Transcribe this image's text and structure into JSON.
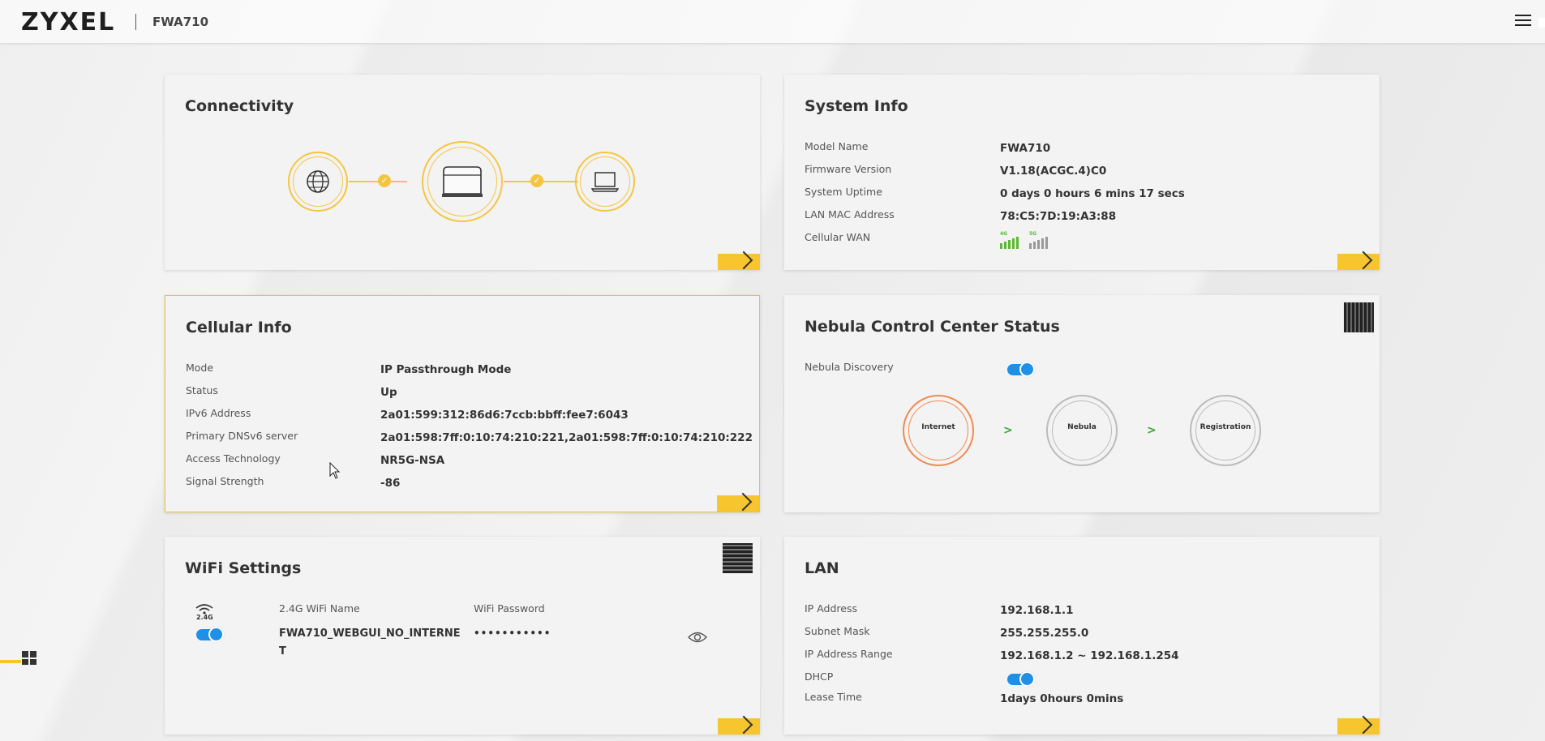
{
  "header": {
    "brand": "ZYXEL",
    "model": "FWA710"
  },
  "connectivity": {
    "title": "Connectivity"
  },
  "system_info": {
    "title": "System Info",
    "rows": [
      {
        "label": "Model Name",
        "value": "FWA710"
      },
      {
        "label": "Firmware Version",
        "value": "V1.18(ACGC.4)C0"
      },
      {
        "label": "System Uptime",
        "value": "0 days 0 hours 6 mins 17 secs"
      },
      {
        "label": "LAN MAC Address",
        "value": "78:C5:7D:19:A3:88"
      },
      {
        "label": "Cellular WAN",
        "value": ""
      }
    ],
    "signal_4g": "4G",
    "signal_5g": "5G",
    "colors": {
      "4g": "#5cb832",
      "5g": "#999999"
    }
  },
  "cellular_info": {
    "title": "Cellular Info",
    "rows": [
      {
        "label": "Mode",
        "value": "IP Passthrough Mode"
      },
      {
        "label": "Status",
        "value": "Up"
      },
      {
        "label": "IPv6 Address",
        "value": "2a01:599:312:86d6:7ccb:bbff:fee7:6043"
      },
      {
        "label": "Primary DNSv6 server",
        "value": "2a01:598:7ff:0:10:74:210:221,2a01:598:7ff:0:10:74:210:222"
      },
      {
        "label": "Access Technology",
        "value": "NR5G-NSA"
      },
      {
        "label": "Signal Strength",
        "value": "-86"
      }
    ]
  },
  "nebula": {
    "title": "Nebula Control Center Status",
    "discovery_label": "Nebula Discovery",
    "discovery_enabled": true,
    "steps": [
      "Internet",
      "Nebula",
      "Registration"
    ],
    "arrow": ">"
  },
  "wifi": {
    "title": "WiFi Settings",
    "band": "2.4G",
    "enabled": true,
    "name_label": "2.4G WiFi Name",
    "name_value_line1": "FWA710_WEBGUI_NO_INTERNE",
    "name_value_line2": "T",
    "password_label": "WiFi Password",
    "password_value": "•••••••••••"
  },
  "lan": {
    "title": "LAN",
    "rows": [
      {
        "label": "IP Address",
        "value": "192.168.1.1"
      },
      {
        "label": "Subnet Mask",
        "value": "255.255.255.0"
      },
      {
        "label": "IP Address Range",
        "value": "192.168.1.2 ~ 192.168.1.254"
      },
      {
        "label": "DHCP",
        "value": ""
      },
      {
        "label": "Lease Time",
        "value": "1days 0hours 0mins"
      }
    ],
    "dhcp_enabled": true
  }
}
